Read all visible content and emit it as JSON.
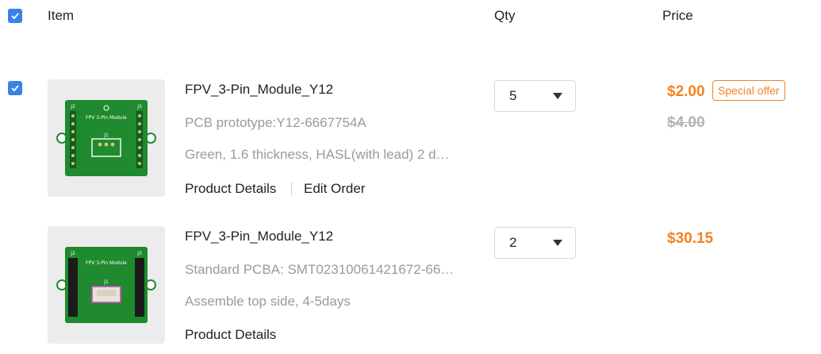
{
  "header": {
    "item": "Item",
    "qty": "Qty",
    "price": "Price"
  },
  "items": [
    {
      "name": "FPV_3-Pin_Module_Y12",
      "line1": "PCB prototype:Y12-6667754A",
      "line2": "Green, 1.6 thickness, HASL(with lead) 2 d…",
      "link1": "Product Details",
      "link2": "Edit Order",
      "qty": "5",
      "price": "$2.00",
      "badge": "Special offer",
      "old_price": "$4.00",
      "board_text": "FPV 3-Pin Module",
      "board_labels": [
        "J2",
        "J3",
        "J1"
      ]
    },
    {
      "name": "FPV_3-Pin_Module_Y12",
      "line1": "Standard PCBA: SMT02310061421672-66…",
      "line2": "Assemble top side, 4-5days",
      "link1": "Product Details",
      "qty": "2",
      "price": "$30.15",
      "board_text": "FPV 3-Pin Module",
      "board_labels": [
        "J2",
        "J3",
        "J1"
      ]
    }
  ],
  "colors": {
    "checkbox": "#3b82e6",
    "price": "#f5821f",
    "board_green": "#1f8a2e"
  }
}
